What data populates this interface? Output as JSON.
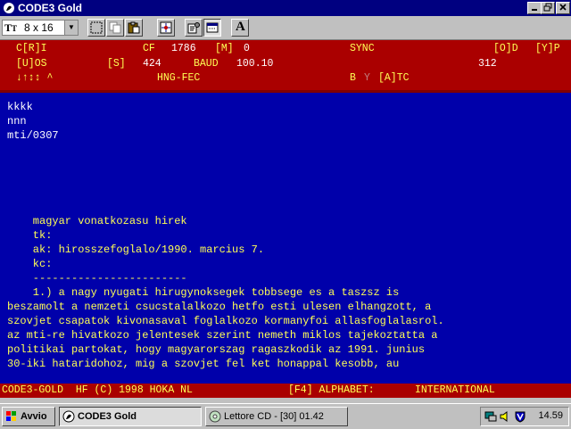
{
  "window": {
    "title": "CODE3 Gold",
    "minimize_icon": "minimize-icon",
    "restore_icon": "restore-icon",
    "close_icon": "close-icon"
  },
  "toolbar": {
    "font_selector_icon": "truetype-icon",
    "font_size": "8 x 16",
    "buttons": [
      "select-icon",
      "copy-icon",
      "paste-icon",
      "target-icon",
      "properties-icon",
      "window-icon",
      "font-icon"
    ],
    "font_button_label": "A"
  },
  "status_panel": {
    "row1": {
      "cri": "C[R]I",
      "cf_label": "CF",
      "cf_value": "1786",
      "m_label": "[M]",
      "m_value": "0",
      "sync": "SYNC",
      "od": "[O]D",
      "yp": "[Y]P"
    },
    "row2": {
      "uos": "[U]OS",
      "s_label": "[S]",
      "s_value": "424",
      "baud_label": "BAUD",
      "baud_value": "100.10",
      "right_value": "312"
    },
    "row3": {
      "arrows": "↓↑↕↕ ^",
      "mode": "HNG-FEC",
      "b": "B",
      "y": "Y",
      "atc": "[A]TC"
    }
  },
  "terminal_lines": [
    "kkkk",
    "nnn",
    "mti/0307",
    "",
    "",
    "",
    "",
    "    magyar vonatkozasu hirek",
    "    tk:",
    "    ak: hirosszefoglalo/1990. marcius 7.",
    "    kc:",
    "    ------------------------",
    "    1.) a nagy nyugati hirugynoksegek tobbsege es a taszsz is",
    "beszamolt a nemzeti csucstalalkozo hetfo esti ulesen elhangzott, a",
    "szovjet csapatok kivonasaval foglalkozo kormanyfoi allasfoglalasrol.",
    "az mti-re hivatkozo jelentesek szerint nemeth miklos tajekoztatta a",
    "politikai partokat, hogy magyarorszag ragaszkodik az 1991. junius",
    "30-iki hataridohoz, mig a szovjet fel ket honappal kesobb, au"
  ],
  "bottom_status": {
    "left": "CODE3-GOLD  HF (C) 1998 HOKA NL",
    "f4": "[F4] ALPHABET:",
    "alphabet": "INTERNATIONAL"
  },
  "taskbar": {
    "start_label": "Avvio",
    "tasks": [
      {
        "label": "CODE3 Gold",
        "icon": "code3-app-icon",
        "active": true
      },
      {
        "label": "Lettore CD - [30] 01.42",
        "icon": "cd-player-icon",
        "active": false
      }
    ],
    "tray_icons": [
      "network-icon",
      "volume-icon",
      "antivirus-icon"
    ],
    "clock": "14.59"
  },
  "colors": {
    "title_bar": "#000080",
    "status_bg": "#aa0000",
    "terminal_bg": "#0000aa",
    "terminal_text": "#ffffff",
    "highlight_text": "#ffff55"
  }
}
